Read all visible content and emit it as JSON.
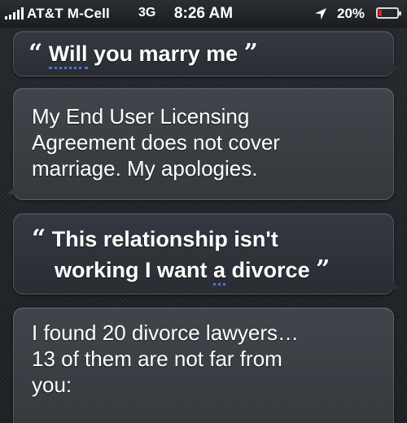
{
  "status_bar": {
    "carrier": "AT&T M-Cell",
    "network": "3G",
    "time": "8:26 AM",
    "battery_percent_label": "20%",
    "battery_level": 0.2,
    "battery_color": "#e0201a",
    "signal_bars": 5
  },
  "conversation": {
    "q1": {
      "open_quote": "“",
      "close_quote": "”",
      "underlined_word": "Will",
      "rest": " you marry me"
    },
    "a1": {
      "lines": [
        "My End User Licensing",
        "Agreement does not cover",
        "marriage. My apologies."
      ]
    },
    "q2": {
      "open_quote": "“",
      "close_quote": "”",
      "line1": "This relationship isn't",
      "line2_before": "working I want ",
      "underlined_word": "a",
      "line2_after": " divorce"
    },
    "a2": {
      "lines": [
        "I found 20 divorce lawyers…",
        "13 of them are not far from",
        "you:"
      ]
    }
  },
  "colors": {
    "dictation_underline": "#4f72d8"
  }
}
